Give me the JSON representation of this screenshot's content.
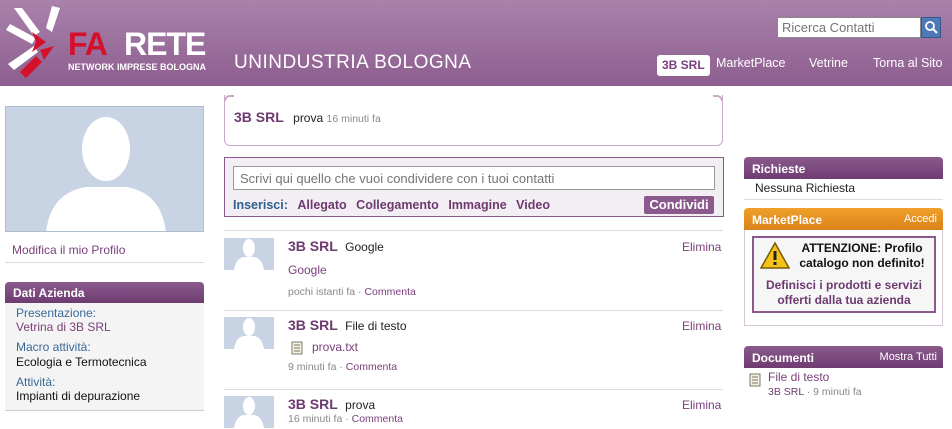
{
  "header": {
    "logo_fa": "FA",
    "logo_rete": "RETE",
    "logo_sub": "NETWORK IMPRESE BOLOGNA",
    "org_name": "UNINDUSTRIA BOLOGNA",
    "search_placeholder": "Ricerca Contatti",
    "nav": [
      "3B SRL",
      "MarketPlace",
      "Vetrine",
      "Torna al Sito"
    ]
  },
  "left": {
    "edit_profile": "Modifica il mio Profilo",
    "panel_title": "Dati Azienda",
    "fields": [
      {
        "label": "Presentazione:",
        "value": "Vetrina di 3B SRL"
      },
      {
        "label": "Macro attività:",
        "value": "Ecologia e Termotecnica"
      },
      {
        "label": "Attività:",
        "value": "Impianti di depurazione"
      }
    ]
  },
  "top_post": {
    "author": "3B SRL",
    "text": "prova",
    "time": "16 minuti fa"
  },
  "share": {
    "placeholder": "Scrivi qui quello che vuoi condividere con i tuoi contatti",
    "insert_label": "Inserisci:",
    "links": [
      "Allegato",
      "Collegamento",
      "Immagine",
      "Video"
    ],
    "button": "Condividi"
  },
  "feed": [
    {
      "author": "3B SRL",
      "text": "Google",
      "attachment": "Google",
      "time": "pochi istanti fa",
      "comment": "Commenta",
      "delete": "Elimina"
    },
    {
      "author": "3B SRL",
      "text": "File di testo",
      "attachment": "prova.txt",
      "time": "9 minuti fa",
      "comment": "Commenta",
      "delete": "Elimina"
    },
    {
      "author": "3B SRL",
      "text": "prova",
      "time": "16 minuti fa",
      "comment": "Commenta",
      "delete": "Elimina"
    }
  ],
  "right": {
    "requests_title": "Richieste",
    "requests_text": "Nessuna Richiesta",
    "market_title": "MarketPlace",
    "market_action": "Accedi",
    "warning_title": "ATTENZIONE: Profilo catalogo non definito!",
    "warning_text": "Definisci i prodotti e servizi offerti dalla tua azienda",
    "docs_title": "Documenti",
    "docs_action": "Mostra Tutti",
    "doc_name": "File di testo",
    "doc_author": "3B SRL",
    "doc_time": "9 minuti fa"
  },
  "colors": {
    "brand": "#8b5a8d",
    "accent_orange": "#e8921f",
    "logo_red": "#d4102a"
  }
}
